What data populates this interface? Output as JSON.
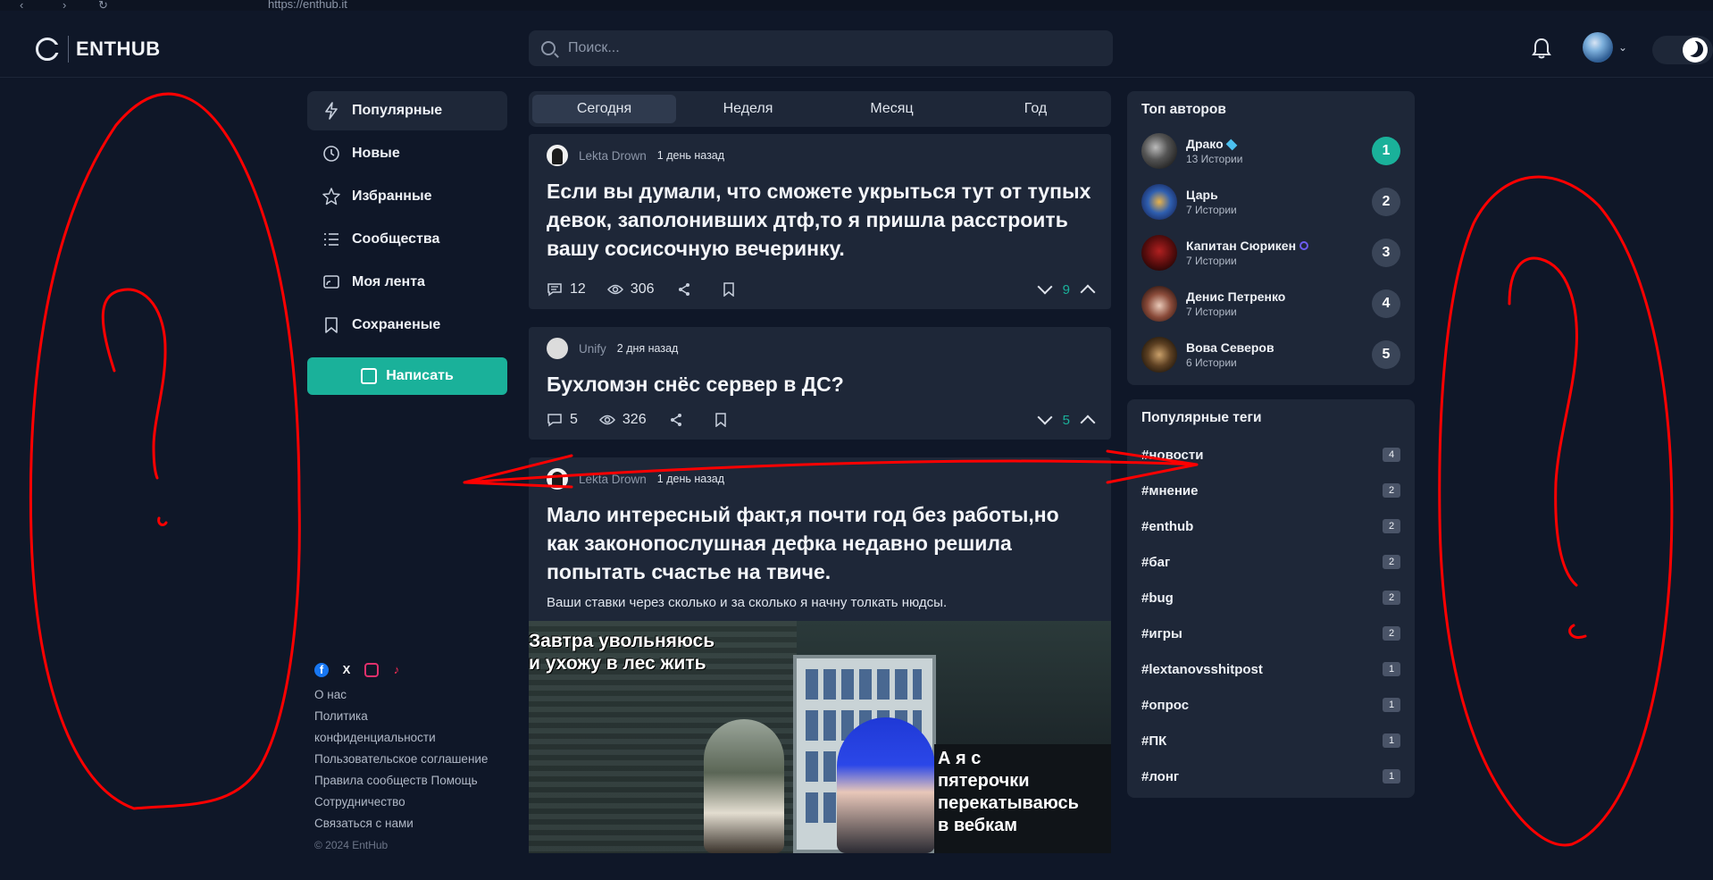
{
  "browser": {
    "url": "https://enthub.it"
  },
  "header": {
    "logo_text": "ENTHUB",
    "search_placeholder": "Поиск..."
  },
  "nav": {
    "items": [
      {
        "label": "Популярные",
        "icon": "lightning-icon"
      },
      {
        "label": "Новые",
        "icon": "clock-icon"
      },
      {
        "label": "Избранные",
        "icon": "star-icon"
      },
      {
        "label": "Сообщества",
        "icon": "list-icon"
      },
      {
        "label": "Моя лента",
        "icon": "feed-icon"
      },
      {
        "label": "Сохраненые",
        "icon": "bookmark-icon"
      }
    ],
    "write_label": "Написать"
  },
  "footer": {
    "links": [
      "О нас",
      "Политика",
      "конфиденциальности",
      "Пользовательское соглашение",
      "Правила сообществ  Помощь",
      "Сотрудничество",
      "Связаться с нами"
    ],
    "copyright": "© 2024 EntHub",
    "social": {
      "fb_color": "#1877f2",
      "ig_color": "#e1306c",
      "tiktok_color": "#ff2d55"
    }
  },
  "feed": {
    "tabs": [
      "Сегодня",
      "Неделя",
      "Месяц",
      "Год"
    ],
    "posts": [
      {
        "author": "Lekta Drown",
        "time": "1 день назад",
        "title": "Если вы думали, что сможете укрыться тут от тупых девок, заполонивших дтф,то я пришла расстроить вашу сосисочную вечеринку.",
        "comments": "12",
        "views": "306",
        "score": "9"
      },
      {
        "author": "Unify",
        "time": "2 дня назад",
        "title": "Бухломэн снёс сервер в ДС?",
        "comments": "5",
        "views": "326",
        "score": "5"
      },
      {
        "author": "Lekta Drown",
        "time": "1 день назад",
        "title": "Мало интересный факт,я почти год без работы,но как законопослушная дефка недавно решила попытать счастье на твиче.",
        "excerpt": "Ваши ставки через сколько и за сколько я начну толкать нюдсы.",
        "image_caption_top": "Завтра увольняюсь\nи ухожу в лес жить",
        "image_caption_bottom": "А я с\nпятерочки\nперекатываюсь\nв вебкам"
      }
    ]
  },
  "top_authors": {
    "title": "Топ авторов",
    "items": [
      {
        "name": "Драко",
        "stories": "13 Истории",
        "rank": "1"
      },
      {
        "name": "Царь",
        "stories": "7 Истории",
        "rank": "2"
      },
      {
        "name": "Капитан Сюрикен",
        "stories": "7 Истории",
        "rank": "3"
      },
      {
        "name": "Денис Петренко",
        "stories": "7 Истории",
        "rank": "4"
      },
      {
        "name": "Вова Северов",
        "stories": "6 Истории",
        "rank": "5"
      }
    ]
  },
  "tags": {
    "title": "Популярные теги",
    "items": [
      {
        "name": "#новости",
        "count": "4"
      },
      {
        "name": "#мнение",
        "count": "2"
      },
      {
        "name": "#enthub",
        "count": "2"
      },
      {
        "name": "#баг",
        "count": "2"
      },
      {
        "name": "#bug",
        "count": "2"
      },
      {
        "name": "#игры",
        "count": "2"
      },
      {
        "name": "#lextanovsshitpost",
        "count": "1"
      },
      {
        "name": "#опрос",
        "count": "1"
      },
      {
        "name": "#ПК",
        "count": "1"
      },
      {
        "name": "#лонг",
        "count": "1"
      }
    ]
  },
  "colors": {
    "accent": "#1ab19a",
    "background": "#0f1728",
    "panel": "#1e2738",
    "annotation": "#ff0000"
  }
}
